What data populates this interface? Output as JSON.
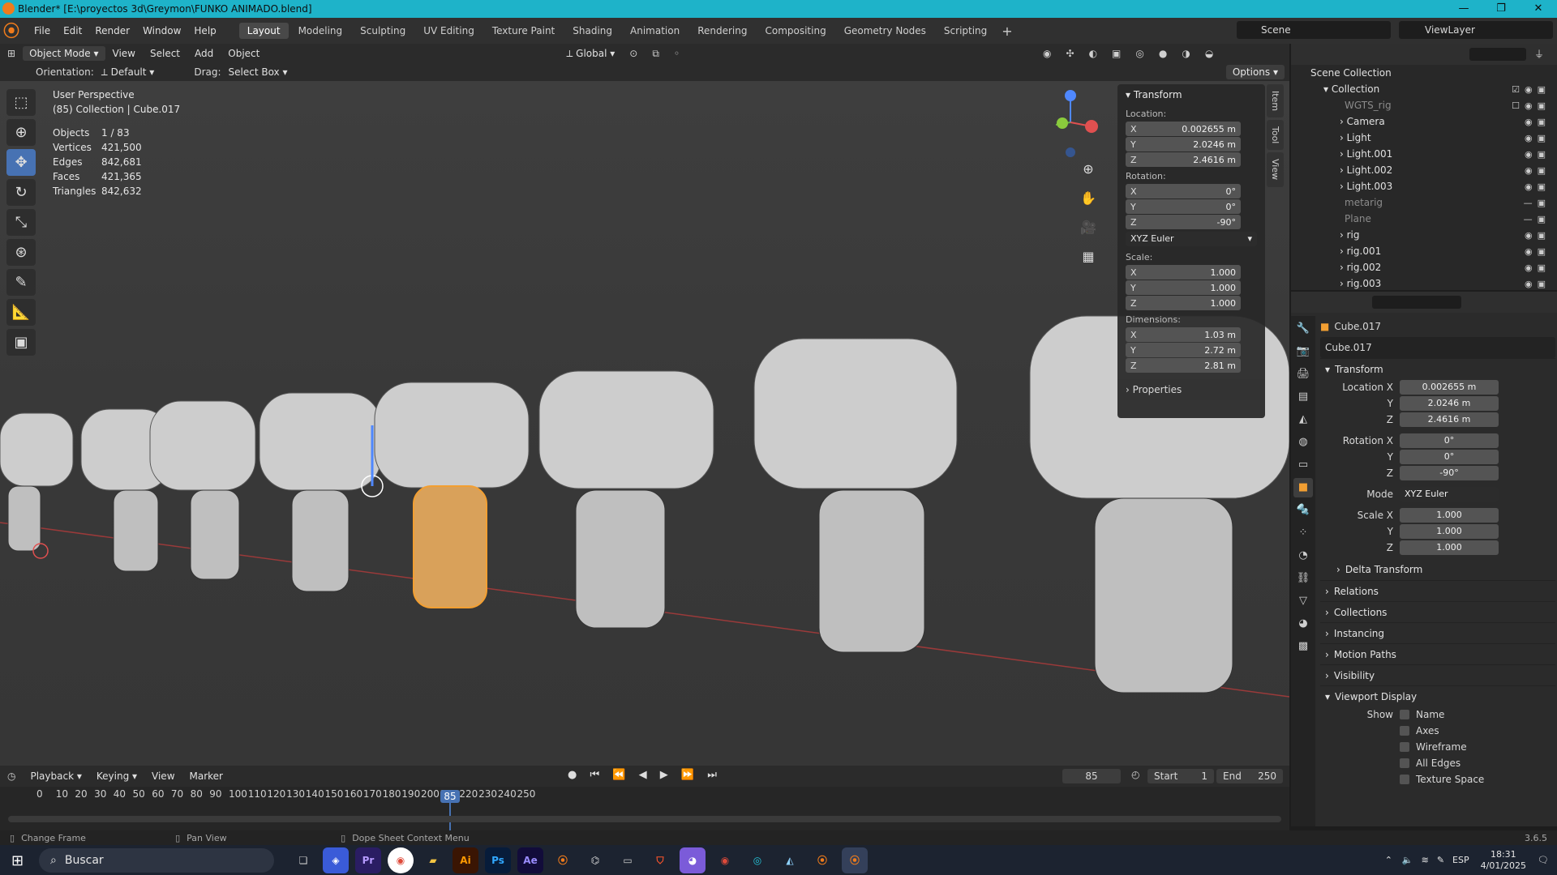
{
  "window": {
    "title": "Blender* [E:\\proyectos 3d\\Greymon\\FUNKO ANIMADO.blend]",
    "controls": [
      "—",
      "❐",
      "✕"
    ]
  },
  "menubar": {
    "menus": [
      "File",
      "Edit",
      "Render",
      "Window",
      "Help"
    ],
    "workspaces": [
      "Layout",
      "Modeling",
      "Sculpting",
      "UV Editing",
      "Texture Paint",
      "Shading",
      "Animation",
      "Rendering",
      "Compositing",
      "Geometry Nodes",
      "Scripting"
    ],
    "active_workspace": "Layout",
    "scene": "Scene",
    "view_layer": "ViewLayer"
  },
  "viewport_header": {
    "mode": "Object Mode",
    "menus": [
      "View",
      "Select",
      "Add",
      "Object"
    ],
    "transform_orientation": "Global",
    "options_label": "Options"
  },
  "viewport_subheader": {
    "orientation_label": "Orientation:",
    "orientation_value": "Default",
    "drag_label": "Drag:",
    "drag_value": "Select Box"
  },
  "viewport": {
    "view_name": "User Perspective",
    "collection_info": "(85) Collection | Cube.017",
    "stats": [
      {
        "label": "Objects",
        "value": "1 / 83"
      },
      {
        "label": "Vertices",
        "value": "421,500"
      },
      {
        "label": "Edges",
        "value": "842,681"
      },
      {
        "label": "Faces",
        "value": "421,365"
      },
      {
        "label": "Triangles",
        "value": "842,632"
      }
    ]
  },
  "npanel": {
    "title": "Transform",
    "location_label": "Location:",
    "location": {
      "x": "0.002655 m",
      "y": "2.0246 m",
      "z": "2.4616 m"
    },
    "rotation_label": "Rotation:",
    "rotation": {
      "x": "0°",
      "y": "0°",
      "z": "-90°"
    },
    "rotation_mode": "XYZ Euler",
    "scale_label": "Scale:",
    "scale": {
      "x": "1.000",
      "y": "1.000",
      "z": "1.000"
    },
    "dimensions_label": "Dimensions:",
    "dimensions": {
      "x": "1.03 m",
      "y": "2.72 m",
      "z": "2.81 m"
    },
    "properties_label": "Properties",
    "tabs": [
      "Item",
      "Tool",
      "View"
    ]
  },
  "outliner": {
    "root": "Scene Collection",
    "collection": "Collection",
    "items": [
      {
        "name": "WGTS_rig",
        "dim": true
      },
      {
        "name": "Camera",
        "dim": false
      },
      {
        "name": "Light",
        "dim": false
      },
      {
        "name": "Light.001",
        "dim": false
      },
      {
        "name": "Light.002",
        "dim": false
      },
      {
        "name": "Light.003",
        "dim": false
      },
      {
        "name": "metarig",
        "dim": true
      },
      {
        "name": "Plane",
        "dim": true
      },
      {
        "name": "rig",
        "dim": false
      },
      {
        "name": "rig.001",
        "dim": false
      },
      {
        "name": "rig.002",
        "dim": false
      },
      {
        "name": "rig.003",
        "dim": false
      }
    ]
  },
  "properties": {
    "object_name": "Cube.017",
    "datablock": "Cube.017",
    "transform_label": "Transform",
    "location_x_label": "Location X",
    "location": {
      "x": "0.002655 m",
      "y": "2.0246 m",
      "z": "2.4616 m"
    },
    "rotation_x_label": "Rotation X",
    "rotation": {
      "x": "0°",
      "y": "0°",
      "z": "-90°"
    },
    "mode_label": "Mode",
    "mode_value": "XYZ Euler",
    "scale_x_label": "Scale X",
    "scale": {
      "x": "1.000",
      "y": "1.000",
      "z": "1.000"
    },
    "y_label": "Y",
    "z_label": "Z",
    "delta_transform": "Delta Transform",
    "sections": [
      "Relations",
      "Collections",
      "Instancing",
      "Motion Paths",
      "Visibility",
      "Viewport Display"
    ],
    "show_label": "Show",
    "show_options": [
      "Name",
      "Axes",
      "Wireframe",
      "All Edges",
      "Texture Space"
    ]
  },
  "timeline": {
    "menus": [
      "Playback",
      "Keying",
      "View",
      "Marker"
    ],
    "current_frame": "85",
    "start_label": "Start",
    "start": "1",
    "end_label": "End",
    "end": "250",
    "ticks": [
      "0",
      "10",
      "20",
      "30",
      "40",
      "50",
      "60",
      "70",
      "80",
      "90",
      "100",
      "110",
      "120",
      "130",
      "140",
      "150",
      "160",
      "170",
      "180",
      "190",
      "200",
      "210",
      "220",
      "230",
      "240",
      "250"
    ],
    "version": "3.6.5"
  },
  "statusbar": {
    "items": [
      "Change Frame",
      "Pan View",
      "Dope Sheet Context Menu"
    ]
  },
  "taskbar": {
    "search_placeholder": "Buscar",
    "time": "18:31",
    "date": "4/01/2025",
    "lang": "ESP"
  },
  "colors": {
    "accent": "#4772b3",
    "titlebar": "#1eb3c9",
    "selected_outline": "#f29f32"
  }
}
